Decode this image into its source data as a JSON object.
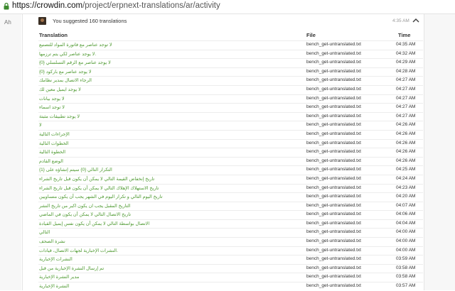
{
  "browser": {
    "url_host": "https://crowdin.com",
    "url_path": "/project/erpnext-translations/ar/activity"
  },
  "sidebar": {
    "lang_code": "Ah"
  },
  "activity": {
    "summary": "You suggested 160 translations",
    "time": "4:35 AM"
  },
  "table": {
    "headers": {
      "translation": "Translation",
      "file": "File",
      "time": "Time"
    },
    "rows": [
      {
        "translation": "لا توجد عناصر مع فاتورة المواد للتصنيع",
        "file": "bench_get-untranslated.txt",
        "time": "04:35 AM"
      },
      {
        "translation": "لا يوجد عناصر لكي يتم ترزمها.",
        "file": "bench_get-untranslated.txt",
        "time": "04:32 AM"
      },
      {
        "translation": "لا يوجد عناصر مع الرقم التسلسلي {0}",
        "file": "bench_get-untranslated.txt",
        "time": "04:29 AM"
      },
      {
        "translation": "لا يوجد عناصر مع باركود {0}",
        "file": "bench_get-untranslated.txt",
        "time": "04:28 AM"
      },
      {
        "translation": "الرجاء الاتصال بمدير نظامك",
        "file": "bench_get-untranslated.txt",
        "time": "04:27 AM"
      },
      {
        "translation": "لا يوجد ايميل معين لك",
        "file": "bench_get-untranslated.txt",
        "time": "04:27 AM"
      },
      {
        "translation": "لا يوجد بيانات",
        "file": "bench_get-untranslated.txt",
        "time": "04:27 AM"
      },
      {
        "translation": "لا توجد اسماء",
        "file": "bench_get-untranslated.txt",
        "time": "04:27 AM"
      },
      {
        "translation": "لا يوجد تطبيقات مثبتة",
        "file": "bench_get-untranslated.txt",
        "time": "04:27 AM"
      },
      {
        "translation": "لا",
        "file": "bench_get-untranslated.txt",
        "time": "04:26 AM"
      },
      {
        "translation": "الإجراءات التالية",
        "file": "bench_get-untranslated.txt",
        "time": "04:26 AM"
      },
      {
        "translation": "الخطوات التالية",
        "file": "bench_get-untranslated.txt",
        "time": "04:26 AM"
      },
      {
        "translation": "الخطوة التالية",
        "file": "bench_get-untranslated.txt",
        "time": "04:26 AM"
      },
      {
        "translation": "الوضع القادم",
        "file": "bench_get-untranslated.txt",
        "time": "04:26 AM"
      },
      {
        "translation": "{1} التكرار التالي {0} سيتم إنشاؤه على",
        "file": "bench_get-untranslated.txt",
        "time": "04:25 AM"
      },
      {
        "translation": "تاريخ إنخفاض القيمة التالي لا يمكن أن يكون قبل تاريخ الشراء",
        "file": "bench_get-untranslated.txt",
        "time": "04:24 AM"
      },
      {
        "translation": "تاريخ الاستهلاك الإهلاك التالي لا يمكن أن يكون قبل تاريخ الشراء",
        "file": "bench_get-untranslated.txt",
        "time": "04:23 AM"
      },
      {
        "translation": "تاريخ اليوم التالي و تكرار اليوم في الشهر يجب أن يكون متساويين",
        "file": "bench_get-untranslated.txt",
        "time": "04:20 AM"
      },
      {
        "translation": "التاريخ المقبل يجب ان يكون اكبر من تاريخ النشر",
        "file": "bench_get-untranslated.txt",
        "time": "04:07 AM"
      },
      {
        "translation": "تاريخ الاتصال التالي لا يمكن أن يكون في الماضي",
        "file": "bench_get-untranslated.txt",
        "time": "04:06 AM"
      },
      {
        "translation": "الاتصال بواسطة التالي لا يمكن أن يكون نفس إيميل القيادة",
        "file": "bench_get-untranslated.txt",
        "time": "04:04 AM"
      },
      {
        "translation": "التالي",
        "file": "bench_get-untranslated.txt",
        "time": "04:00 AM"
      },
      {
        "translation": "نشرة الصحف",
        "file": "bench_get-untranslated.txt",
        "time": "04:00 AM"
      },
      {
        "translation": "النشرات الإخبارية لجهات الاتصال، قيادات.",
        "file": "bench_get-untranslated.txt",
        "time": "04:00 AM"
      },
      {
        "translation": "النشرات الإخبارية",
        "file": "bench_get-untranslated.txt",
        "time": "03:59 AM"
      },
      {
        "translation": "تم إرسال النشرة الإخبارية من قبل",
        "file": "bench_get-untranslated.txt",
        "time": "03:58 AM"
      },
      {
        "translation": "مدير النشرة الإخبارية",
        "file": "bench_get-untranslated.txt",
        "time": "03:58 AM"
      },
      {
        "translation": "النشرة الإخبارية",
        "file": "bench_get-untranslated.txt",
        "time": "03:57 AM"
      }
    ]
  }
}
